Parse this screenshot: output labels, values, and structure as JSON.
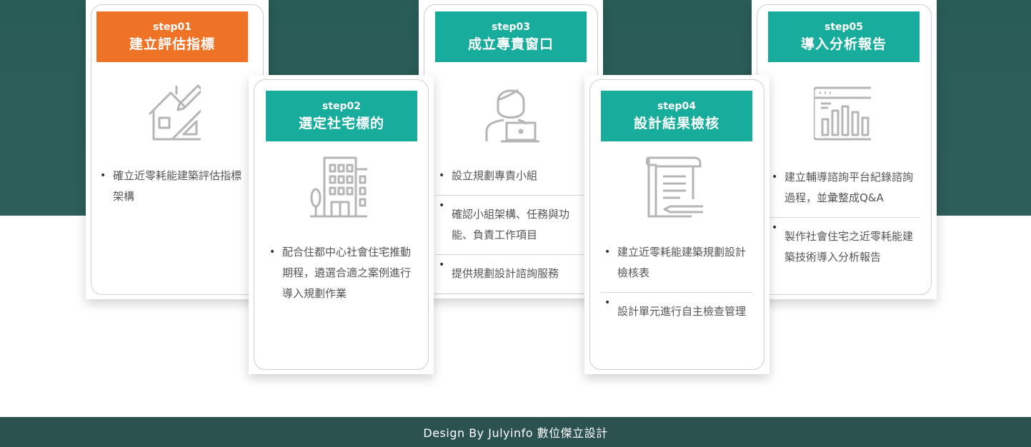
{
  "steps": [
    {
      "step": "step01",
      "title": "建立評估指標",
      "icon": "house-ruler-pencil-icon",
      "items": [
        "確立近零耗能建築評估指標架構"
      ]
    },
    {
      "step": "step02",
      "title": "選定社宅標的",
      "icon": "apartment-building-icon",
      "items": [
        "配合住都中心社會住宅推動期程，遴選合適之案例進行導入規劃作業"
      ]
    },
    {
      "step": "step03",
      "title": "成立專責窗口",
      "icon": "person-laptop-icon",
      "items": [
        "設立規劃專責小組",
        "確認小組架構、任務與功能、負責工作項目",
        "提供規劃設計諮詢服務"
      ]
    },
    {
      "step": "step04",
      "title": "設計結果檢核",
      "icon": "document-scroll-pen-icon",
      "items": [
        "建立近零耗能建築規劃設計檢核表",
        "設計單元進行自主檢查管理"
      ]
    },
    {
      "step": "step05",
      "title": "導入分析報告",
      "icon": "analytics-window-chart-icon",
      "items": [
        "建立輔導諮詢平台紀錄諮詢過程，並彙整成Q&A",
        "製作社會住宅之近零耗能建築技術導入分析報告"
      ]
    }
  ],
  "colors": {
    "accent_orange": "#ee7326",
    "accent_teal": "#17ac9c",
    "band": "#2c5250"
  },
  "footer": {
    "text": "Design By Julyinfo 數位傑立設計"
  }
}
